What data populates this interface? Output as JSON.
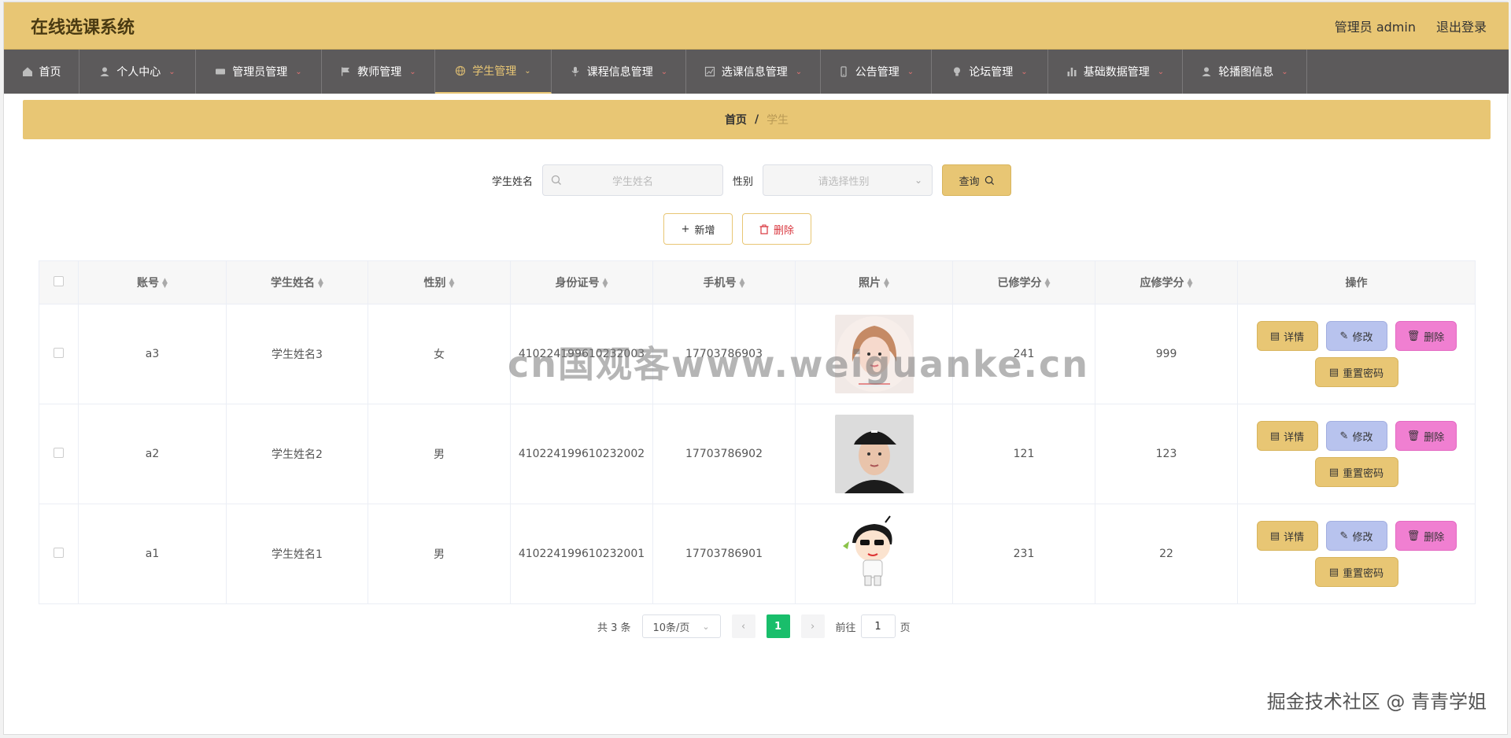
{
  "header": {
    "title": "在线选课系统",
    "user": "管理员 admin",
    "logout": "退出登录"
  },
  "nav": [
    {
      "label": "首页",
      "icon": "home-icon",
      "caret": false,
      "active": false
    },
    {
      "label": "个人中心",
      "icon": "user-icon",
      "caret": true,
      "active": false
    },
    {
      "label": "管理员管理",
      "icon": "ticket-icon",
      "caret": true,
      "active": false
    },
    {
      "label": "教师管理",
      "icon": "flag-icon",
      "caret": true,
      "active": false
    },
    {
      "label": "学生管理",
      "icon": "globe-icon",
      "caret": true,
      "active": true
    },
    {
      "label": "课程信息管理",
      "icon": "mic-icon",
      "caret": true,
      "active": false
    },
    {
      "label": "选课信息管理",
      "icon": "chart-icon",
      "caret": true,
      "active": false
    },
    {
      "label": "公告管理",
      "icon": "phone-icon",
      "caret": true,
      "active": false
    },
    {
      "label": "论坛管理",
      "icon": "bulb-icon",
      "caret": true,
      "active": false
    },
    {
      "label": "基础数据管理",
      "icon": "bar-chart-icon",
      "caret": true,
      "active": false
    },
    {
      "label": "轮播图信息",
      "icon": "user-icon",
      "caret": true,
      "active": false
    }
  ],
  "breadcrumb": {
    "home": "首页",
    "sep": "/",
    "current": "学生"
  },
  "search": {
    "name_label": "学生姓名",
    "name_placeholder": "学生姓名",
    "gender_label": "性别",
    "gender_placeholder": "请选择性别",
    "query": "查询"
  },
  "actions": {
    "add": "新增",
    "delete": "删除"
  },
  "table": {
    "columns": [
      "账号",
      "学生姓名",
      "性别",
      "身份证号",
      "手机号",
      "照片",
      "已修学分",
      "应修学分",
      "操作"
    ],
    "rows": [
      {
        "account": "a3",
        "name": "学生姓名3",
        "gender": "女",
        "idcard": "410224199610232003",
        "phone": "17703786903",
        "photo": "girl-avatar",
        "earned": "241",
        "required": "999"
      },
      {
        "account": "a2",
        "name": "学生姓名2",
        "gender": "男",
        "idcard": "410224199610232002",
        "phone": "17703786902",
        "photo": "boy-avatar",
        "earned": "121",
        "required": "123"
      },
      {
        "account": "a1",
        "name": "学生姓名1",
        "gender": "男",
        "idcard": "410224199610232001",
        "phone": "17703786901",
        "photo": "cartoon-avatar",
        "earned": "231",
        "required": "22"
      }
    ],
    "ops": {
      "detail": "详情",
      "edit": "修改",
      "remove": "删除",
      "reset": "重置密码"
    }
  },
  "pagination": {
    "total": "共 3 条",
    "size": "10条/页",
    "current": "1",
    "goto_prefix": "前往",
    "goto_value": "1",
    "goto_suffix": "页"
  },
  "overlay": {
    "watermark": "cn国观客www.weiguanke.cn",
    "corner": "掘金技术社区 @ 青青学姐"
  },
  "colors": {
    "header": "#e8c674",
    "nav": "#5c5a5b",
    "active": "#e8c674",
    "pager_current": "#19be6b"
  }
}
